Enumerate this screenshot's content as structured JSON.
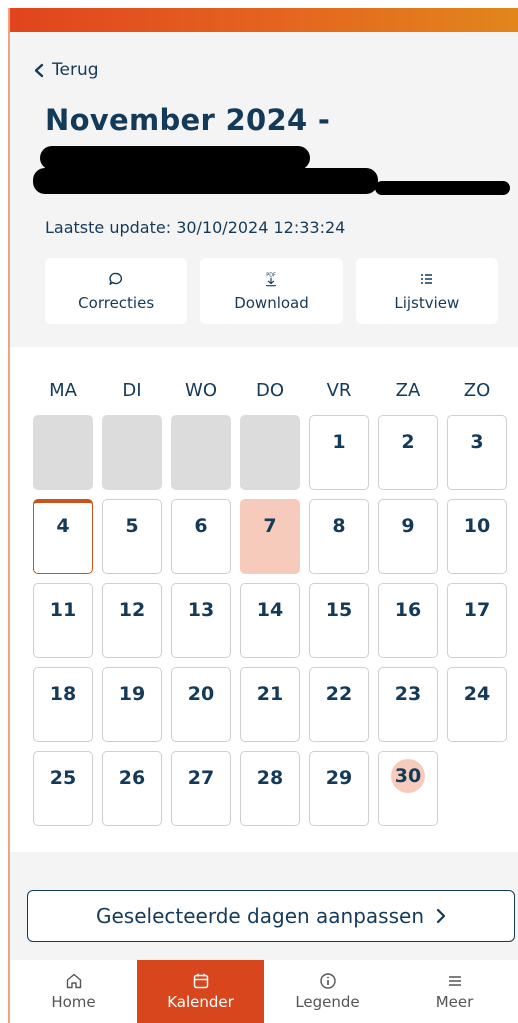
{
  "header": {
    "back_label": "Terug",
    "title": "November 2024 -",
    "last_update": "Laatste update: 30/10/2024 12:33:24"
  },
  "actions": [
    {
      "label": "Correcties",
      "icon": "chat-bubble-icon"
    },
    {
      "label": "Download",
      "icon": "pdf-download-icon",
      "icon_text": "PDF"
    },
    {
      "label": "Lijstview",
      "icon": "list-icon"
    }
  ],
  "calendar": {
    "weekdays": [
      "MA",
      "DI",
      "WO",
      "DO",
      "VR",
      "ZA",
      "ZO"
    ],
    "leading_empty": 4,
    "days": [
      "1",
      "2",
      "3",
      "4",
      "5",
      "6",
      "7",
      "8",
      "9",
      "10",
      "11",
      "12",
      "13",
      "14",
      "15",
      "16",
      "17",
      "18",
      "19",
      "20",
      "21",
      "22",
      "23",
      "24",
      "25",
      "26",
      "27",
      "28",
      "29",
      "30"
    ],
    "today": "4",
    "highlighted": "7",
    "circled": "30"
  },
  "adjust_button": {
    "label": "Geselecteerde dagen aanpassen"
  },
  "tabbar": [
    {
      "label": "Home",
      "icon": "home-icon",
      "active": false
    },
    {
      "label": "Kalender",
      "icon": "calendar-icon",
      "active": true
    },
    {
      "label": "Legende",
      "icon": "info-icon",
      "active": false
    },
    {
      "label": "Meer",
      "icon": "menu-icon",
      "active": false
    }
  ],
  "colors": {
    "accent": "#d7461c",
    "navy": "#143a5a",
    "highlight": "#f6cbbb"
  }
}
